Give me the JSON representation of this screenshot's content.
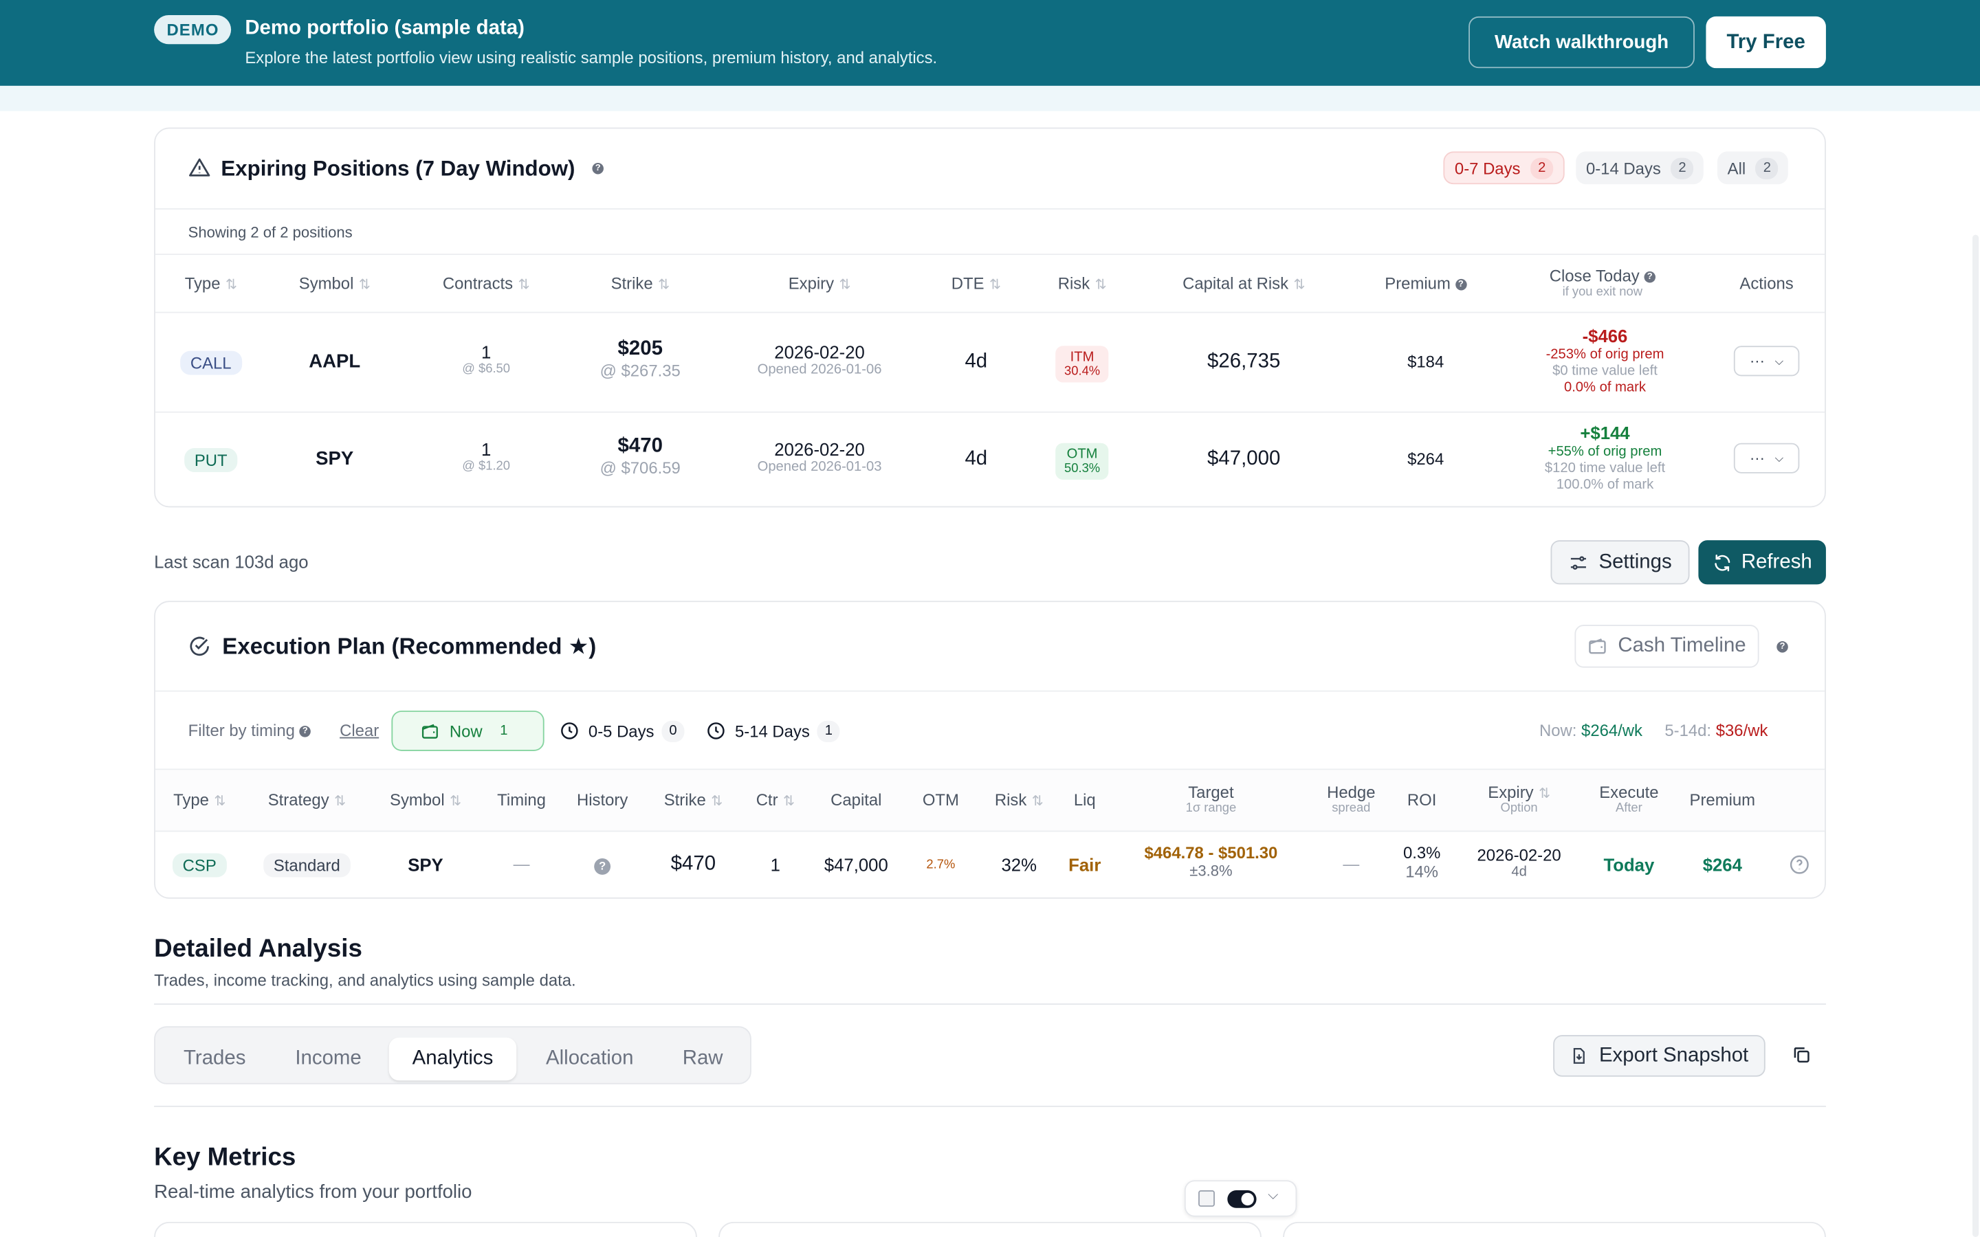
{
  "banner": {
    "badge": "DEMO",
    "title": "Demo portfolio (sample data)",
    "subtitle": "Explore the latest portfolio view using realistic sample positions, premium history, and analytics.",
    "walkthrough": "Watch walkthrough",
    "try_free": "Try Free"
  },
  "expiring": {
    "title": "Expiring Positions (7 Day Window)",
    "filters": [
      {
        "label": "0-7 Days",
        "count": "2"
      },
      {
        "label": "0-14 Days",
        "count": "2"
      },
      {
        "label": "All",
        "count": "2"
      }
    ],
    "showing": "Showing 2 of 2 positions",
    "columns": {
      "type": "Type",
      "symbol": "Symbol",
      "contracts": "Contracts",
      "strike": "Strike",
      "expiry": "Expiry",
      "dte": "DTE",
      "risk": "Risk",
      "capital": "Capital at Risk",
      "premium": "Premium",
      "close_today": "Close Today",
      "close_today_hint": "if you exit now",
      "actions": "Actions"
    },
    "rows": [
      {
        "type": "CALL",
        "symbol": "AAPL",
        "contracts": "1",
        "contracts_sub": "@ $6.50",
        "strike": "$205",
        "strike_sub": "@ $267.35",
        "expiry": "2026-02-20",
        "opened": "Opened 2026-01-06",
        "dte": "4d",
        "risk": "ITM",
        "risk_pct": "30.4%",
        "capital": "$26,735",
        "premium": "$184",
        "close": "-$466",
        "close_l1": "-253% of orig prem",
        "close_l2": "$0 time value left",
        "close_l3": "0.0% of mark",
        "actions": "···"
      },
      {
        "type": "PUT",
        "symbol": "SPY",
        "contracts": "1",
        "contracts_sub": "@ $1.20",
        "strike": "$470",
        "strike_sub": "@ $706.59",
        "expiry": "2026-02-20",
        "opened": "Opened 2026-01-03",
        "dte": "4d",
        "risk": "OTM",
        "risk_pct": "50.3%",
        "capital": "$47,000",
        "premium": "$264",
        "close": "+$144",
        "close_l1": "+55% of orig prem",
        "close_l2": "$120 time value left",
        "close_l3": "100.0% of mark",
        "actions": "···"
      }
    ]
  },
  "scan": {
    "last": "Last scan 103d ago",
    "settings": "Settings",
    "refresh": "Refresh"
  },
  "plan": {
    "title": "Execution Plan (Recommended ★)",
    "cash_timeline": "Cash Timeline",
    "filter_label": "Filter by timing",
    "clear": "Clear",
    "now": "Now",
    "now_count": "1",
    "d05": "0-5 Days",
    "d05_count": "0",
    "d514": "5-14 Days",
    "d514_count": "1",
    "summary_now_label": "Now:",
    "summary_now": "$264/wk",
    "summary_514_label": "5-14d:",
    "summary_514": "$36/wk",
    "columns": {
      "type": "Type",
      "strategy": "Strategy",
      "symbol": "Symbol",
      "timing": "Timing",
      "history": "History",
      "strike": "Strike",
      "ctr": "Ctr",
      "capital": "Capital",
      "otm": "OTM",
      "risk": "Risk",
      "liq": "Liq",
      "target": "Target",
      "target_hint": "1σ range",
      "hedge": "Hedge",
      "hedge_hint": "spread",
      "roi": "ROI",
      "expiry": "Expiry",
      "expiry_hint": "Option",
      "execute": "Execute",
      "execute_hint": "After",
      "premium": "Premium"
    },
    "row": {
      "type": "CSP",
      "strategy": "Standard",
      "symbol": "SPY",
      "timing": "—",
      "strike": "$470",
      "ctr": "1",
      "capital": "$47,000",
      "otm": "2.7%",
      "risk": "32%",
      "liq": "Fair",
      "target": "$464.78 - $501.30",
      "target_sub": "±3.8%",
      "hedge": "—",
      "roi": "0.3%",
      "roi_sub": "14%",
      "expiry": "2026-02-20",
      "expiry_sub": "4d",
      "execute": "Today",
      "premium": "$264"
    }
  },
  "analysis": {
    "title": "Detailed Analysis",
    "subtitle": "Trades, income tracking, and analytics using sample data.",
    "tabs": [
      "Trades",
      "Income",
      "Analytics",
      "Allocation",
      "Raw"
    ],
    "active_tab": "Analytics",
    "export": "Export Snapshot"
  },
  "metrics": {
    "title": "Key Metrics",
    "subtitle": "Real-time analytics from your portfolio"
  },
  "colors": {
    "brand": "#0e6c80",
    "accent_dark": "#0f5a64",
    "red": "#b91c1c",
    "green": "#15803d"
  }
}
